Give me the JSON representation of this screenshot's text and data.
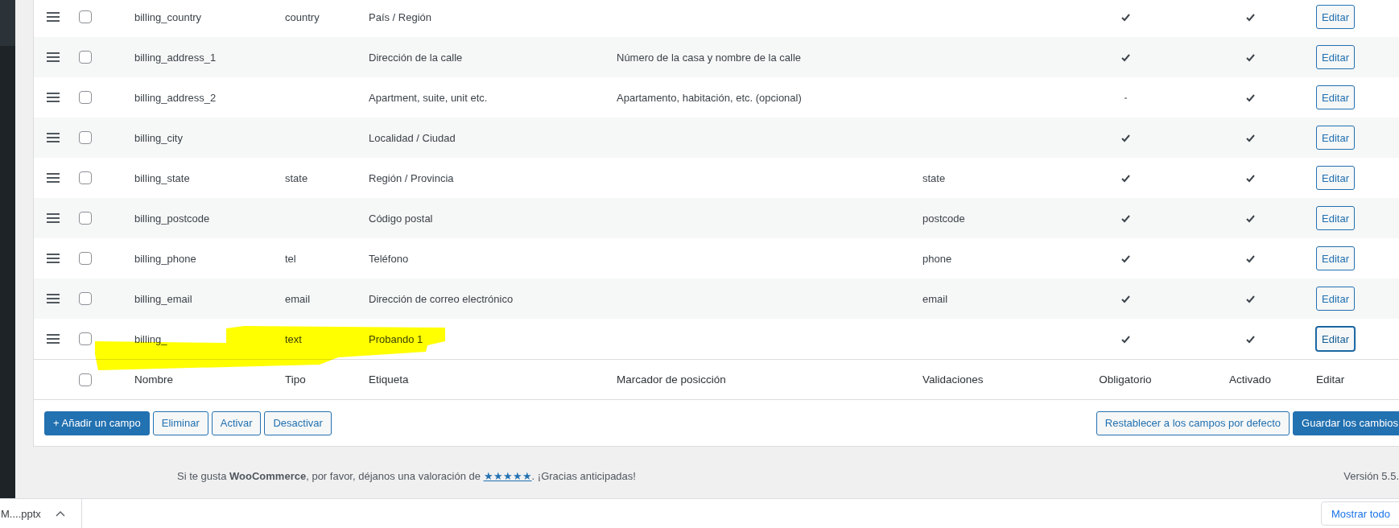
{
  "fields_table": {
    "rows": [
      {
        "name": "billing_country",
        "type": "country",
        "label": "País / Región",
        "required": true,
        "enabled": true,
        "checked": false,
        "edit": "Editar",
        "focused": false
      },
      {
        "name": "billing_address_1",
        "label": "Dirección de la calle",
        "position_marker": "Número de la casa y nombre de la calle",
        "required": true,
        "enabled": true,
        "checked": false,
        "edit": "Editar",
        "focused": false
      },
      {
        "name": "billing_address_2",
        "label": "Apartment, suite, unit etc.",
        "position_marker": "Apartamento, habitación, etc. (opcional)",
        "required": false,
        "enabled": true,
        "checked": false,
        "edit": "Editar",
        "focused": false
      },
      {
        "name": "billing_city",
        "label": "Localidad / Ciudad",
        "required": true,
        "enabled": true,
        "checked": false,
        "edit": "Editar",
        "focused": false
      },
      {
        "name": "billing_state",
        "type": "state",
        "label": "Región / Provincia",
        "validation": "state",
        "required": true,
        "enabled": true,
        "checked": false,
        "edit": "Editar",
        "focused": false
      },
      {
        "name": "billing_postcode",
        "label": "Código postal",
        "validation": "postcode",
        "required": true,
        "enabled": true,
        "checked": false,
        "edit": "Editar",
        "focused": false
      },
      {
        "name": "billing_phone",
        "type": "tel",
        "label": "Teléfono",
        "validation": "phone",
        "required": true,
        "enabled": true,
        "checked": false,
        "edit": "Editar",
        "focused": false
      },
      {
        "name": "billing_email",
        "type": "email",
        "label": "Dirección de correo electrónico",
        "validation": "email",
        "required": true,
        "enabled": true,
        "checked": false,
        "edit": "Editar",
        "focused": false
      },
      {
        "name": "billing_",
        "type": "text",
        "label": "Probando 1",
        "required": true,
        "enabled": true,
        "checked": false,
        "edit": "Editar",
        "focused": true
      }
    ],
    "footer": {
      "select_all_checked": false,
      "columns": [
        "Nombre",
        "Tipo",
        "Etiqueta",
        "Marcador de posicción",
        "Validaciones",
        "Obligatorio",
        "Activado",
        "Editar"
      ]
    }
  },
  "actions_left": [
    {
      "label": "+ Añadir un campo",
      "primary": true
    },
    {
      "label": "Eliminar",
      "primary": false
    },
    {
      "label": "Activar",
      "primary": false
    },
    {
      "label": "Desactivar",
      "primary": false
    }
  ],
  "actions_right": [
    {
      "label": "Restablecer a los campos por defecto",
      "primary": false
    },
    {
      "label": "Guardar los cambios",
      "primary": true
    }
  ],
  "admin_footer": {
    "before": "Si te gusta **WooCommerce**, por favor, déjanos una valoración de ",
    "rating_link": "★★★★★",
    "after": ". ¡Gracias anticipadas!",
    "version": "Versión 5.5."
  },
  "download_bar": {
    "file": "M....pptx",
    "show_all": "Mostrar todo"
  }
}
